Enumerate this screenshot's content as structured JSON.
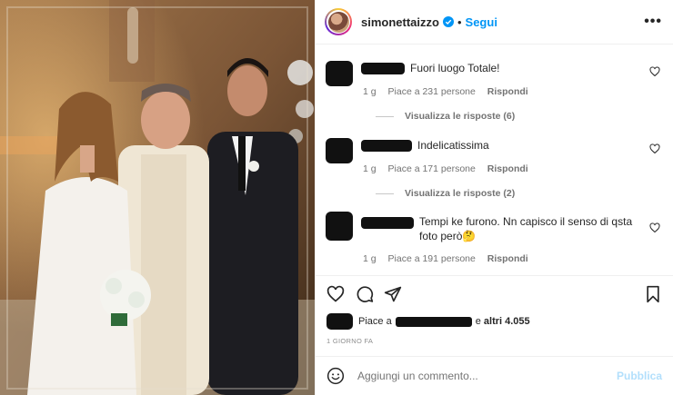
{
  "post": {
    "username": "simonettaizzo",
    "follow_label": "Segui",
    "separator": "•",
    "more_label": "•••",
    "image_icon": "wedding-photo"
  },
  "comments": [
    {
      "text": "Fuori luogo Totale!",
      "time": "1 g",
      "likes": "Piace a 231 persone",
      "reply": "Rispondi",
      "view_replies": "Visualizza le risposte (6)"
    },
    {
      "text": "Indelicatissima",
      "time": "1 g",
      "likes": "Piace a 171 persone",
      "reply": "Rispondi",
      "view_replies": "Visualizza le risposte (2)"
    },
    {
      "text": "Tempi ke furono. Nn capisco il senso di qsta foto però🤔",
      "time": "1 g",
      "likes": "Piace a 191 persone",
      "reply": "Rispondi"
    }
  ],
  "likes": {
    "prefix": "Piace a",
    "connector": "e",
    "others": "altri 4.055"
  },
  "time_ago": "1 GIORNO FA",
  "add_comment": {
    "placeholder": "Aggiungi un commento...",
    "publish": "Pubblica"
  },
  "colors": {
    "accent": "#0095f6",
    "publish_disabled": "#b2dffc",
    "muted": "#737373"
  }
}
